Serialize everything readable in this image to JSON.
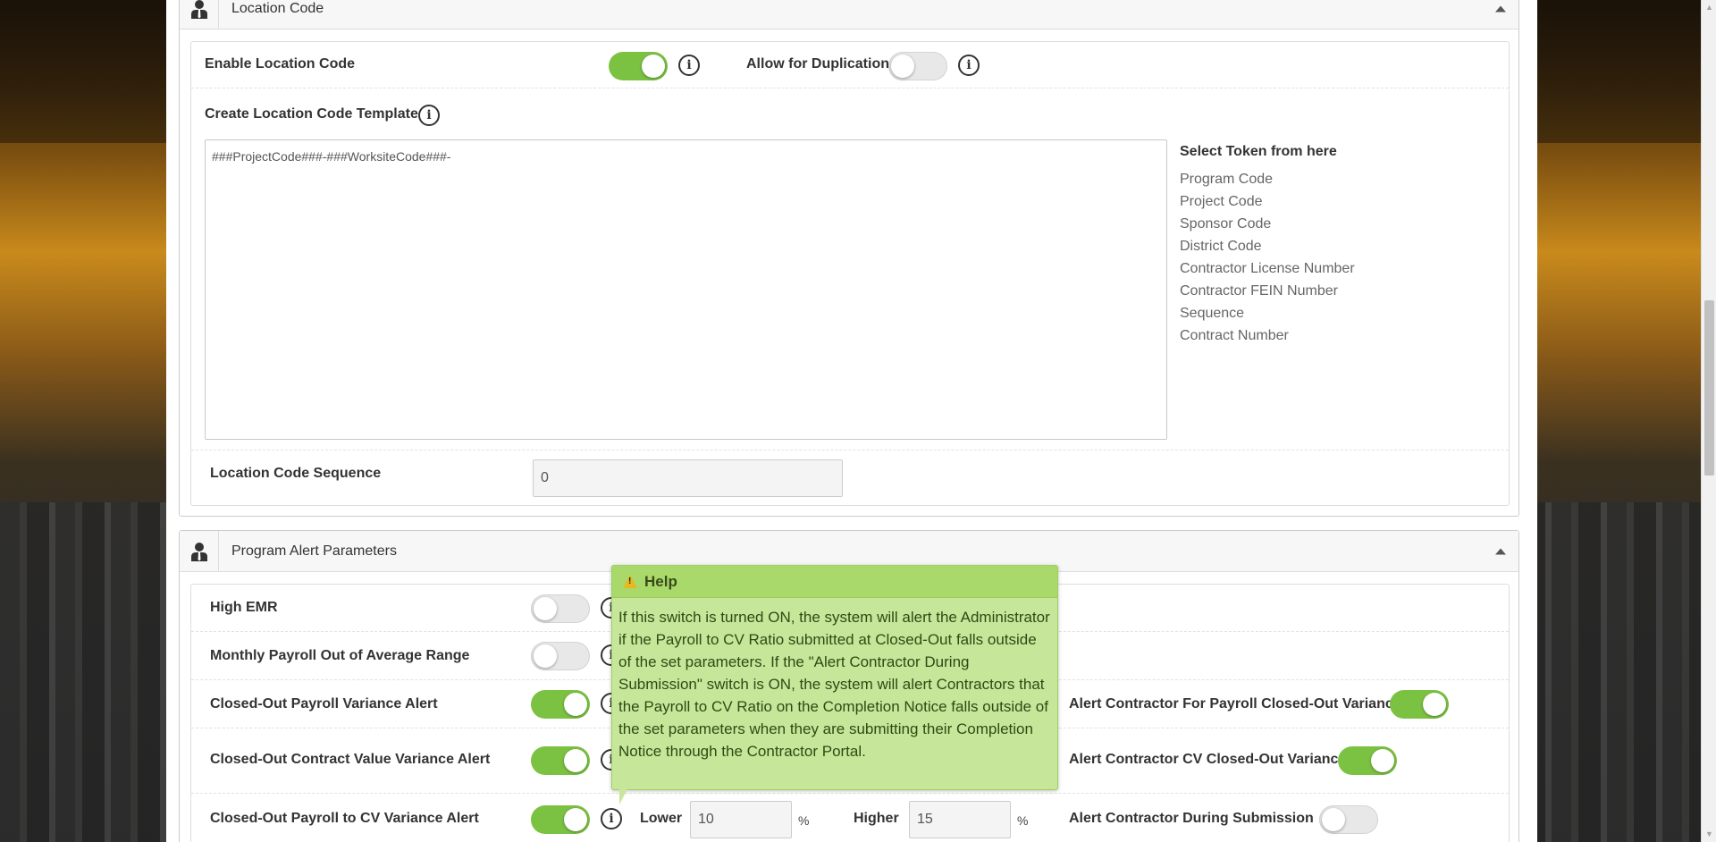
{
  "location_code": {
    "title": "Location Code",
    "enable_label": "Enable Location Code",
    "enable_on": true,
    "allow_dup_label": "Allow for Duplication",
    "allow_dup_on": false,
    "template_label": "Create Location Code Template",
    "template_value": "###ProjectCode###-###WorksiteCode###-",
    "tokens_title": "Select Token from here",
    "tokens": [
      "Program Code",
      "Project Code",
      "Sponsor Code",
      "District Code",
      "Contractor License Number",
      "Contractor FEIN Number",
      "Sequence",
      "Contract Number"
    ],
    "sequence_label": "Location Code Sequence",
    "sequence_value": "0"
  },
  "program_alert": {
    "title": "Program Alert Parameters",
    "rows": [
      {
        "label": "High EMR",
        "on": false
      },
      {
        "label": "Monthly Payroll Out of Average Range",
        "on": false
      },
      {
        "label": "Closed-Out Payroll Variance Alert",
        "on": true,
        "side_label": "Alert Contractor For Payroll Closed-Out Variance",
        "side_on": true
      },
      {
        "label": "Closed-Out Contract Value Variance Alert",
        "on": true,
        "side_label": "Alert Contractor CV Closed-Out Variance",
        "side_on": true
      },
      {
        "label": "Closed-Out Payroll to CV Variance Alert",
        "on": true,
        "side_label": "Alert Contractor During Submission",
        "side_on": false
      }
    ],
    "lower_label": "Lower",
    "lower_value": "10",
    "higher_label": "Higher",
    "higher_value": "15",
    "pct": "%"
  },
  "help_tip": {
    "title": "Help",
    "body": "If this switch is turned ON, the system will alert the Administrator if the Payroll to CV Ratio submitted at Closed-Out falls outside of the set parameters. If the \"Alert Contractor During Submission\" switch is ON, the system will alert Contractors that the Payroll to CV Ratio on the Completion Notice falls outside of the set parameters when they are submitting their Completion Notice through the Contractor Portal."
  },
  "icons": {
    "panel_icon": "user-tie-icon",
    "info_icon": "info-icon",
    "collapse_icon": "caret-up-icon",
    "warning_icon": "warning-icon"
  },
  "colors": {
    "toggle_on": "#7cc242",
    "tooltip_bg": "#c6e79a",
    "tooltip_head": "#a8d96a"
  }
}
